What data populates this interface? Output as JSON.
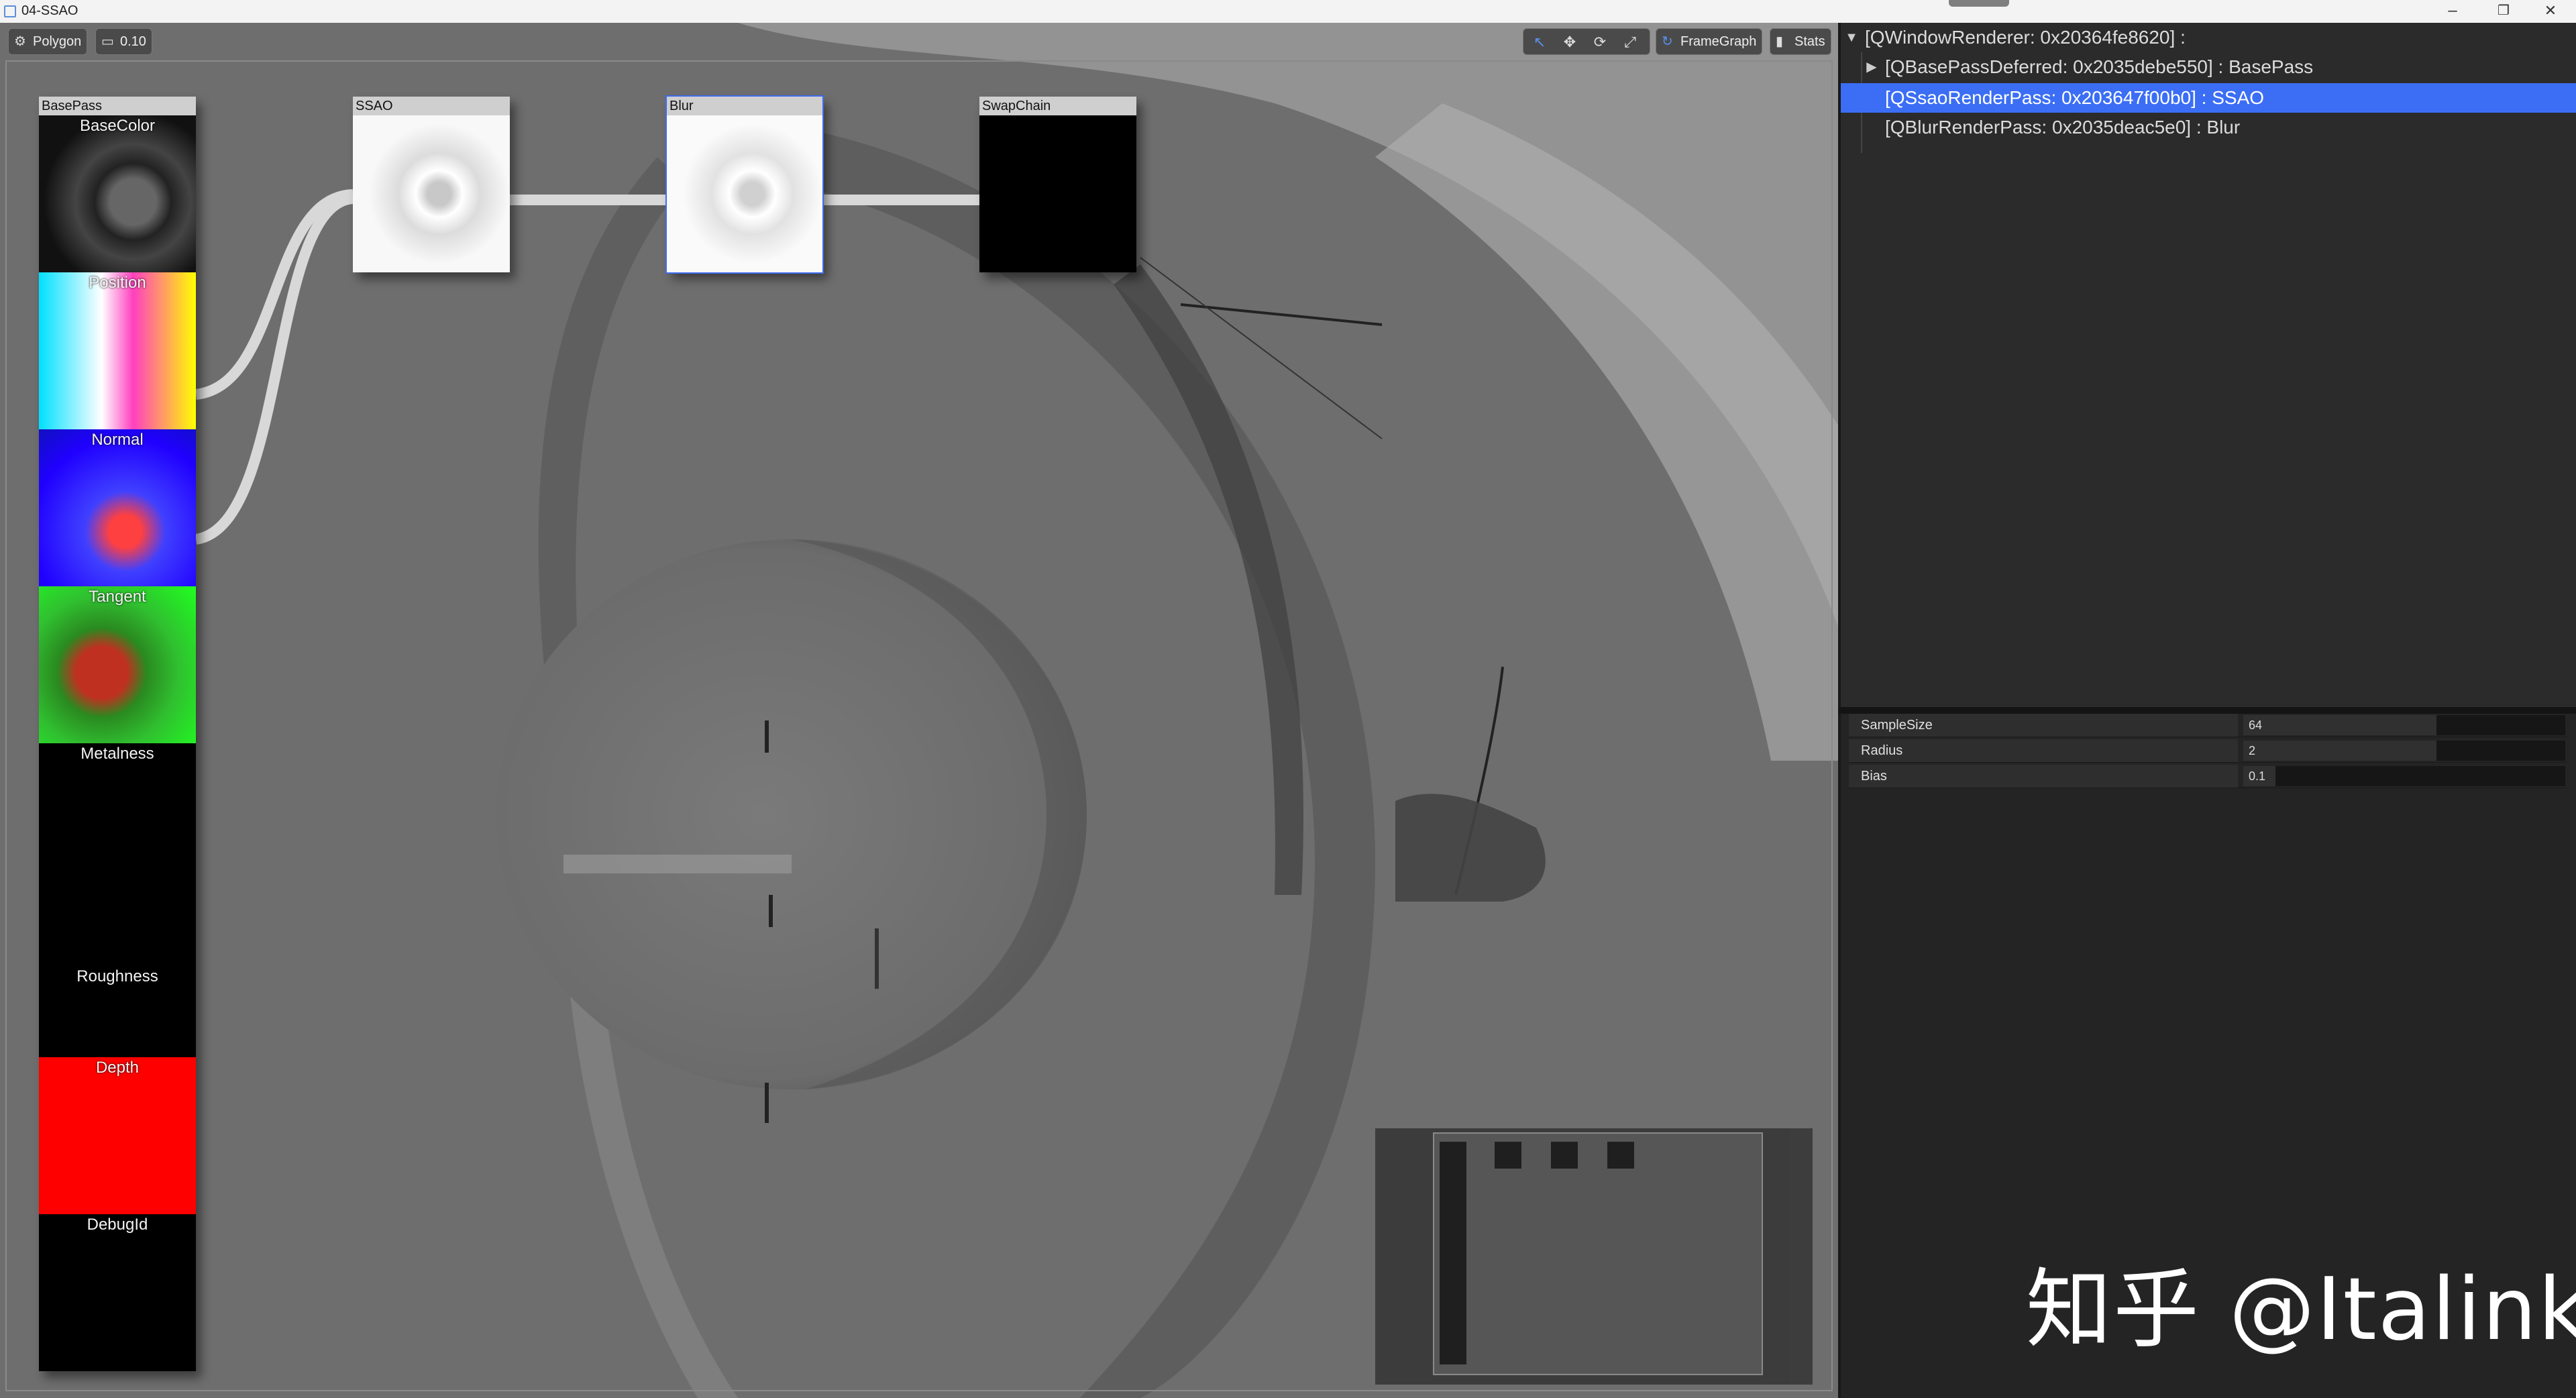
{
  "window": {
    "title": "04-SSAO",
    "minimize": "–",
    "restore": "❐",
    "close": "✕"
  },
  "toolbar": {
    "polygon_label": "Polygon",
    "opacity_label": "0.10",
    "framegraph_label": "FrameGraph",
    "stats_label": "Stats"
  },
  "framegraph": {
    "basepass": {
      "title": "BasePass",
      "slots": [
        "BaseColor",
        "Position",
        "Normal",
        "Tangent",
        "Metalness",
        "Roughness",
        "Depth",
        "DebugId"
      ]
    },
    "ssao": {
      "title": "SSAO"
    },
    "blur": {
      "title": "Blur"
    },
    "swapchain": {
      "title": "SwapChain"
    }
  },
  "tree": {
    "root": "[QWindowRenderer: 0x20364fe8620] :",
    "children": [
      "[QBasePassDeferred: 0x2035debe550] : BasePass",
      "[QSsaoRenderPass: 0x203647f00b0] : SSAO",
      "[QBlurRenderPass: 0x2035deac5e0] : Blur"
    ],
    "selected_index": 1
  },
  "properties": [
    {
      "name": "SampleSize",
      "value": "64",
      "fill": 0.6
    },
    {
      "name": "Radius",
      "value": "2",
      "fill": 0.6
    },
    {
      "name": "Bias",
      "value": "0.1",
      "fill": 0.1
    }
  ],
  "watermark": "知乎 @Italink",
  "colors": {
    "selection": "#3b6ef5",
    "depth_slot": "#ff0000"
  }
}
